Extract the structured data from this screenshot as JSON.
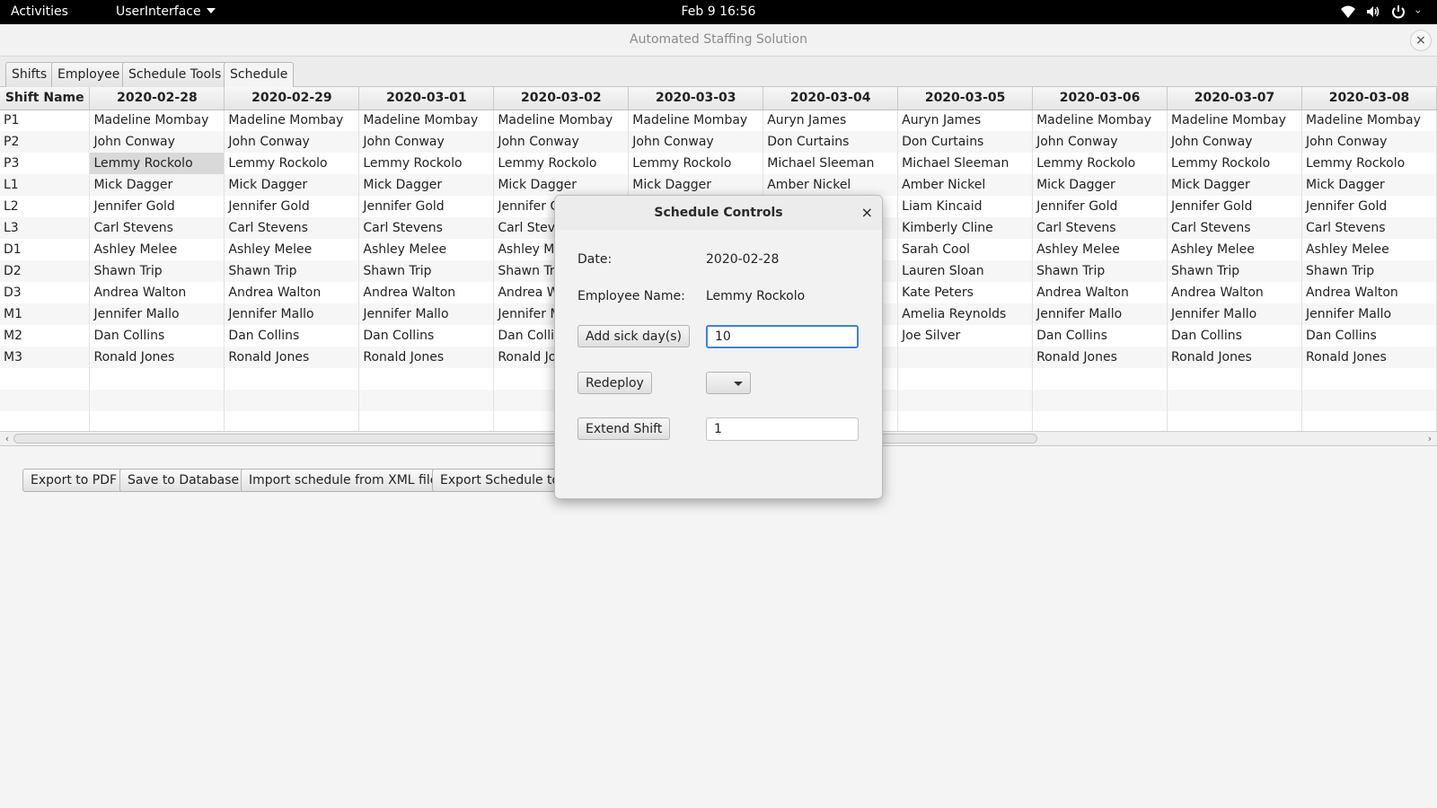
{
  "topbar": {
    "activities": "Activities",
    "app_menu": "UserInterface",
    "clock": "Feb 9  16:56",
    "icons": [
      "wifi-icon",
      "volume-icon",
      "power-icon"
    ]
  },
  "window": {
    "title": "Automated Staffing Solution",
    "close": "×"
  },
  "tabs": [
    "Shifts",
    "Employee",
    "Schedule Tools",
    "Schedule"
  ],
  "table": {
    "headers": [
      "Shift Name",
      "2020-02-28",
      "2020-02-29",
      "2020-03-01",
      "2020-03-02",
      "2020-03-03",
      "2020-03-04",
      "2020-03-05",
      "2020-03-06",
      "2020-03-07",
      "2020-03-08"
    ],
    "rows": [
      [
        "P1",
        "Madeline Mombay",
        "Madeline Mombay",
        "Madeline Mombay",
        "Madeline Mombay",
        "Madeline Mombay",
        "Auryn James",
        "Auryn James",
        "Madeline Mombay",
        "Madeline Mombay",
        "Madeline Mombay"
      ],
      [
        "P2",
        "John Conway",
        "John Conway",
        "John Conway",
        "John Conway",
        "John Conway",
        "Don Curtains",
        "Don Curtains",
        "John Conway",
        "John Conway",
        "John Conway"
      ],
      [
        "P3",
        "Lemmy Rockolo",
        "Lemmy Rockolo",
        "Lemmy Rockolo",
        "Lemmy Rockolo",
        "Lemmy Rockolo",
        "Michael Sleeman",
        "Michael Sleeman",
        "Lemmy Rockolo",
        "Lemmy Rockolo",
        "Lemmy Rockolo"
      ],
      [
        "L1",
        "Mick Dagger",
        "Mick Dagger",
        "Mick Dagger",
        "Mick Dagger",
        "Mick Dagger",
        "Amber Nickel",
        "Amber Nickel",
        "Mick Dagger",
        "Mick Dagger",
        "Mick Dagger"
      ],
      [
        "L2",
        "Jennifer Gold",
        "Jennifer Gold",
        "Jennifer Gold",
        "Jennifer G",
        "",
        "",
        "Liam Kincaid",
        "Jennifer Gold",
        "Jennifer Gold",
        "Jennifer Gold"
      ],
      [
        "L3",
        "Carl Stevens",
        "Carl Stevens",
        "Carl Stevens",
        "Carl Steve",
        "",
        "",
        "Kimberly Cline",
        "Carl Stevens",
        "Carl Stevens",
        "Carl Stevens"
      ],
      [
        "D1",
        "Ashley Melee",
        "Ashley Melee",
        "Ashley Melee",
        "Ashley Me",
        "",
        "",
        "Sarah Cool",
        "Ashley Melee",
        "Ashley Melee",
        "Ashley Melee"
      ],
      [
        "D2",
        "Shawn Trip",
        "Shawn Trip",
        "Shawn Trip",
        "Shawn Tri",
        "",
        "",
        "Lauren Sloan",
        "Shawn Trip",
        "Shawn Trip",
        "Shawn Trip"
      ],
      [
        "D3",
        "Andrea Walton",
        "Andrea Walton",
        "Andrea Walton",
        "Andrea W",
        "",
        "",
        "Kate Peters",
        "Andrea Walton",
        "Andrea Walton",
        "Andrea Walton"
      ],
      [
        "M1",
        "Jennifer Mallo",
        "Jennifer Mallo",
        "Jennifer Mallo",
        "Jennifer M",
        "",
        "",
        "Amelia Reynolds",
        "Jennifer Mallo",
        "Jennifer Mallo",
        "Jennifer Mallo"
      ],
      [
        "M2",
        "Dan Collins",
        "Dan Collins",
        "Dan Collins",
        "Dan Collir",
        "",
        "",
        "Joe Silver",
        "Dan Collins",
        "Dan Collins",
        "Dan Collins"
      ],
      [
        "M3",
        "Ronald Jones",
        "Ronald Jones",
        "Ronald Jones",
        "Ronald Jo",
        "",
        "",
        "",
        "Ronald Jones",
        "Ronald Jones",
        "Ronald Jones"
      ],
      [
        "",
        "",
        "",
        "",
        "",
        "",
        "",
        "",
        "",
        "",
        ""
      ],
      [
        "",
        "",
        "",
        "",
        "",
        "",
        "",
        "",
        "",
        "",
        ""
      ],
      [
        "",
        "",
        "",
        "",
        "",
        "",
        "",
        "",
        "",
        "",
        ""
      ]
    ],
    "selected_cell": "Lemmy Rockolo"
  },
  "buttons": {
    "export_pdf": "Export to PDF",
    "save_db": "Save to Database",
    "import_xml": "Import schedule from XML file",
    "export_schedule": "Export Schedule to"
  },
  "dialog": {
    "title": "Schedule Controls",
    "close": "×",
    "date_label": "Date:",
    "date_value": "2020-02-28",
    "employee_label": "Employee Name:",
    "employee_value": "Lemmy Rockolo",
    "sick_button": "Add sick day(s)",
    "sick_value": "10",
    "redeploy_button": "Redeploy",
    "redeploy_selected": "",
    "extend_button": "Extend Shift",
    "extend_value": "1"
  },
  "colors": {
    "focus_accent": "#3b83d9",
    "selected_cell": "#d9d9d9",
    "topbar": "#000000"
  }
}
